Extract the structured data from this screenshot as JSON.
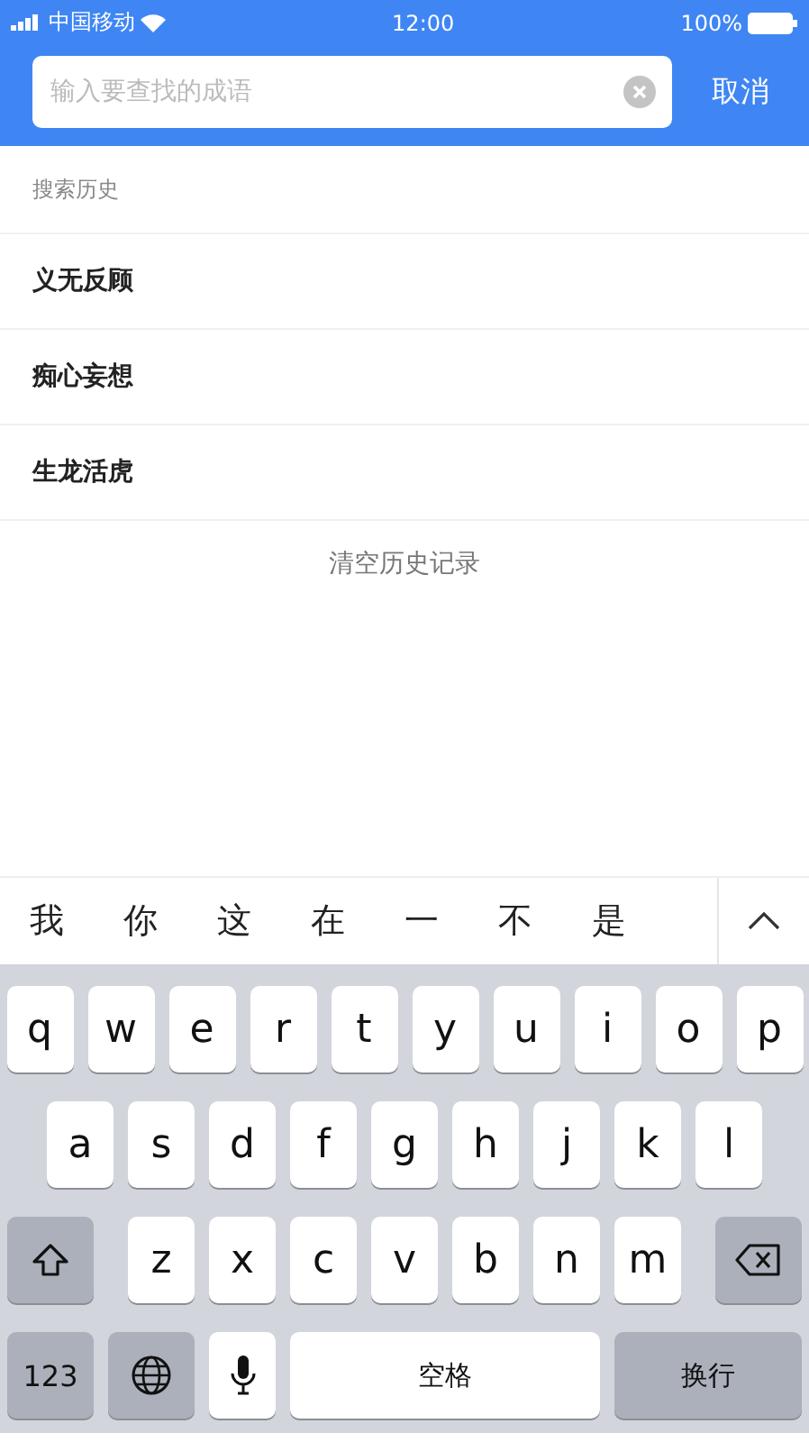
{
  "status_bar": {
    "carrier": "中国移动",
    "time": "12:00",
    "battery": "100%"
  },
  "search": {
    "placeholder": "输入要查找的成语",
    "cancel": "取消"
  },
  "history": {
    "title": "搜索历史",
    "items": [
      "义无反顾",
      "痴心妄想",
      "生龙活虎"
    ],
    "clear": "清空历史记录"
  },
  "candidates": [
    "我",
    "你",
    "这",
    "在",
    "一",
    "不",
    "是"
  ],
  "keyboard": {
    "rows": [
      [
        "q",
        "w",
        "e",
        "r",
        "t",
        "y",
        "u",
        "i",
        "o",
        "p"
      ],
      [
        "a",
        "s",
        "d",
        "f",
        "g",
        "h",
        "j",
        "k",
        "l"
      ],
      [
        "z",
        "x",
        "c",
        "v",
        "b",
        "n",
        "m"
      ]
    ],
    "numbers": "123",
    "space": "空格",
    "return": "换行"
  }
}
